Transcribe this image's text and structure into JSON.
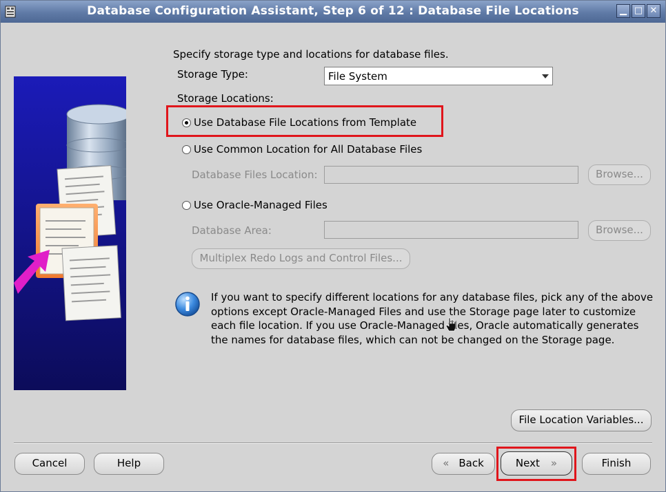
{
  "window": {
    "title": "Database Configuration Assistant, Step 6 of 12 : Database File Locations",
    "controls": [
      "minimize",
      "maximize",
      "close"
    ]
  },
  "intro": "Specify storage type and locations for database files.",
  "storage_type": {
    "label": "Storage Type:",
    "selected": "File System"
  },
  "storage_locations": {
    "label": "Storage Locations:",
    "options": [
      {
        "label": "Use Database File Locations from Template",
        "selected": true
      },
      {
        "label": "Use Common Location for All Database Files",
        "selected": false
      },
      {
        "label": "Use Oracle-Managed Files",
        "selected": false
      }
    ],
    "db_files_location_label": "Database Files Location:",
    "db_files_location_value": "",
    "database_area_label": "Database Area:",
    "database_area_value": "",
    "browse_label": "Browse...",
    "multiplex_label": "Multiplex Redo Logs and Control Files..."
  },
  "info": {
    "icon": "info-icon",
    "lines": [
      "If you want to specify different locations for any database files, pick any of the above",
      "options except Oracle-Managed Files and use the Storage page later to customize",
      "each file location. If you use Oracle-Managed files, Oracle automatically generates",
      "the names for database files, which can not be changed on the Storage page."
    ]
  },
  "buttons": {
    "file_location_variables": "File Location Variables...",
    "cancel": "Cancel",
    "help": "Help",
    "back": "Back",
    "next": "Next",
    "finish": "Finish"
  },
  "colors": {
    "highlight": "#e0151b",
    "titlebar": "#5f7aa6",
    "panel": "#d4d4d4"
  }
}
